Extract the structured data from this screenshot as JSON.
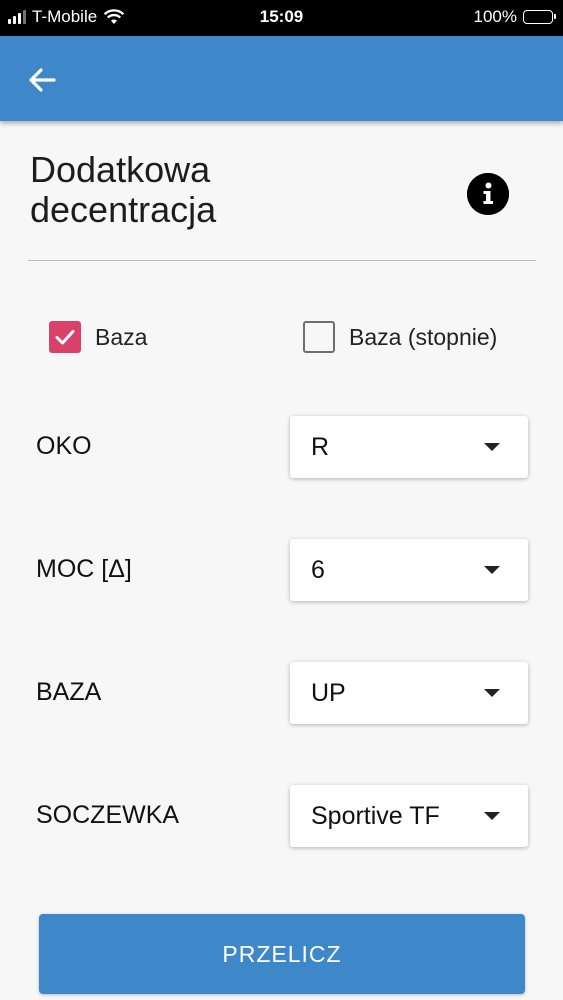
{
  "status_bar": {
    "carrier": "T-Mobile",
    "time": "15:09",
    "battery": "100%"
  },
  "app_bar": {
    "back_icon": "arrow-left-icon"
  },
  "page": {
    "title_line1": "Dodatkowa",
    "title_line2": "decentracja",
    "info_icon": "info-icon"
  },
  "checkboxes": [
    {
      "label": "Baza",
      "checked": true
    },
    {
      "label": "Baza (stopnie)",
      "checked": false
    }
  ],
  "fields": [
    {
      "label": "OKO",
      "value": "R"
    },
    {
      "label": "MOC [Δ]",
      "value": "6"
    },
    {
      "label": "BAZA",
      "value": "UP"
    },
    {
      "label": "SOCZEWKA",
      "value": "Sportive TF"
    }
  ],
  "button": {
    "label": "PRZELICZ"
  },
  "colors": {
    "primary": "#3e88c9",
    "checkbox_accent": "#d8416a"
  }
}
